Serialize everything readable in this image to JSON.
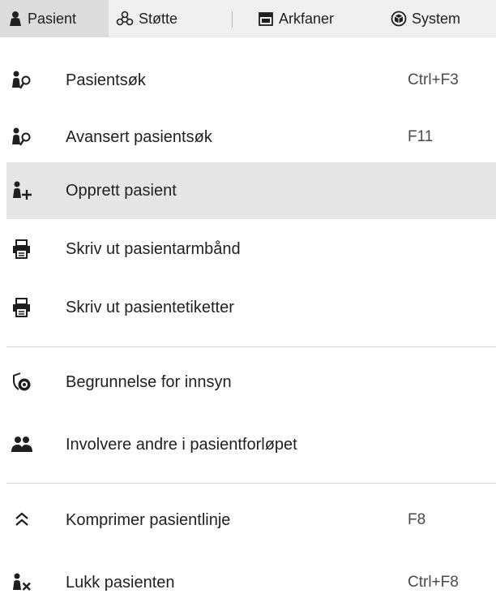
{
  "menubar": {
    "items": [
      {
        "label": "Pasient",
        "icon": "person-icon",
        "active": true
      },
      {
        "label": "Støtte",
        "icon": "support-icon"
      },
      {
        "label": "Arkfaner",
        "icon": "tab-window-icon"
      },
      {
        "label": "System",
        "icon": "cube-icon"
      }
    ]
  },
  "menu": {
    "items": [
      {
        "label": "Pasientsøk",
        "shortcut": "Ctrl+F3",
        "icon": "patient-search-icon"
      },
      {
        "label": "Avansert pasientsøk",
        "shortcut": "F11",
        "icon": "patient-search-icon"
      },
      {
        "label": "Opprett pasient",
        "shortcut": "",
        "icon": "patient-add-icon",
        "highlighted": true
      },
      {
        "label": "Skriv ut pasientarmbånd",
        "shortcut": "",
        "icon": "printer-icon"
      },
      {
        "label": "Skriv ut pasientetiketter",
        "shortcut": "",
        "icon": "printer-icon"
      },
      {
        "label": "Begrunnelse for innsyn",
        "shortcut": "",
        "icon": "shield-eye-icon"
      },
      {
        "label": "Involvere andre i pasientforløpet",
        "shortcut": "",
        "icon": "group-icon"
      },
      {
        "label": "Komprimer pasientlinje",
        "shortcut": "F8",
        "icon": "double-chevron-up-icon"
      },
      {
        "label": "Lukk pasienten",
        "shortcut": "Ctrl+F8",
        "icon": "patient-close-icon"
      }
    ]
  }
}
